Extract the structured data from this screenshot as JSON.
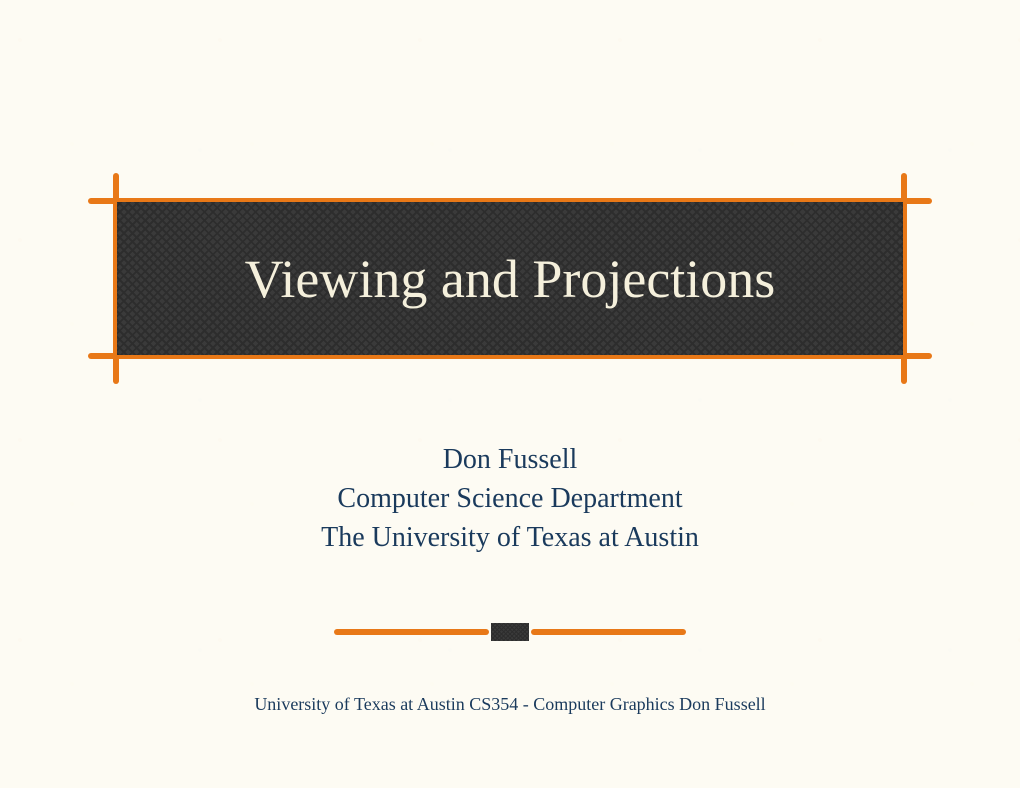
{
  "title": "Viewing and Projections",
  "subtitle": {
    "line1": "Don Fussell",
    "line2": "Computer Science Department",
    "line3": "The University of Texas at Austin"
  },
  "footer": "University of Texas at Austin    CS354  -  Computer Graphics    Don Fussell"
}
